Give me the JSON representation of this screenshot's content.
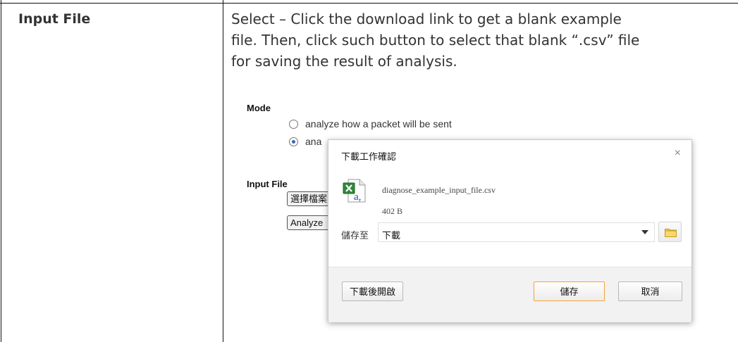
{
  "document": {
    "row_label": "Input File",
    "description_lines": [
      "Select – Click the download link to get a blank example",
      "file. Then, click such button to select that blank “.csv” file",
      "for saving the result of analysis."
    ]
  },
  "screenshot": {
    "mode_heading": "Mode",
    "radio_options": [
      {
        "label": "analyze how a packet will be sent",
        "checked": false
      },
      {
        "label": "ana",
        "checked": true
      }
    ],
    "input_file_heading": "Input File",
    "choose_file_button": "選擇檔案",
    "analyze_button": "Analyze"
  },
  "dialog": {
    "title": "下載工作確認",
    "close_glyph": "×",
    "file_name": "diagnose_example_input_file.csv",
    "file_size": "402 B",
    "save_to_label": "儲存至",
    "save_to_value": "下載",
    "buttons": {
      "open_after": "下載後開啟",
      "save": "儲存",
      "cancel": "取消"
    },
    "icons": [
      "excel-csv-file-icon",
      "folder-icon",
      "chevron-down-icon",
      "close-icon"
    ],
    "colors": {
      "save_border": "#f0a33a",
      "folder": "#f2c94c"
    }
  }
}
